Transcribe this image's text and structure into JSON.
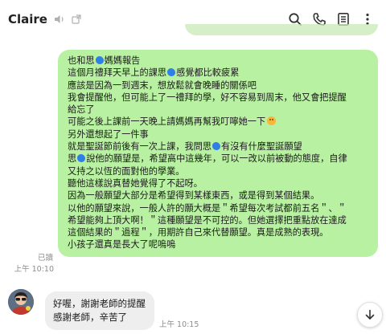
{
  "header": {
    "chat_name": "Claire",
    "icons": [
      "mute-icon",
      "external-window-icon",
      "search-icon",
      "call-icon",
      "notes-icon",
      "menu-icon"
    ]
  },
  "outgoing": {
    "lines": [
      {
        "before": "也和思",
        "blob": true,
        "after": "媽媽報告"
      },
      {
        "before": "這個月禮拜天早上的課思",
        "blob": true,
        "after": "感覺都比較疲累"
      },
      {
        "before": "應該是因為一到週末，想放鬆就會晚睡的關係吧",
        "blob": false,
        "after": ""
      },
      {
        "before": "我會提醒他，但可能上了一禮拜的學，好不容易到周末，他又會把提醒",
        "blob": false,
        "after": ""
      },
      {
        "before": "給忘了",
        "blob": false,
        "after": ""
      },
      {
        "before": "可能之後上課前一天晚上請媽媽再幫我叮嚀她一下",
        "blob": false,
        "after": "",
        "smile": true
      },
      {
        "before": "另外還想起了一件事",
        "blob": false,
        "after": ""
      },
      {
        "before": "就是聖誕節前後有一次上課，我問思",
        "blob": true,
        "after": "有沒有什麼聖誕願望"
      },
      {
        "before": "思",
        "blob": true,
        "after": "說他的願望是，希望高中這幾年，可以一改以前被動的態度，自律"
      },
      {
        "before": "又持之以恆的面對他的學業。",
        "blob": false,
        "after": ""
      },
      {
        "before": "聽他這樣說真替她覺得了不起呀。",
        "blob": false,
        "after": ""
      },
      {
        "before": "因為一般願望大部分是希望得到某樣東西，或是得到某個結果。",
        "blob": false,
        "after": ""
      },
      {
        "before": "以他的願望來說，一般人許的願大概是＂希望每次考試都前五名＂、＂",
        "blob": false,
        "after": ""
      },
      {
        "before": "希望能夠上頂大啊！＂這種願望是不可控的。但她選擇把重點放在達成",
        "blob": false,
        "after": ""
      },
      {
        "before": "這個結果的＂過程＂，用期許自己來代替願望。真是成熟的表現。",
        "blob": false,
        "after": ""
      },
      {
        "before": "小孩子還真是長大了呢嗚嗚",
        "blob": false,
        "after": ""
      }
    ],
    "read_label": "已讀",
    "time": "上午 10:10"
  },
  "incoming": {
    "lines": [
      "好喔，謝謝老師的提醒",
      "感謝老師，辛苦了"
    ],
    "time": "上午 10:15"
  },
  "colors": {
    "outgoing_bubble": "#b9f1a3",
    "incoming_bubble": "#eeeeee",
    "sticker_blob": "#2f7fe6"
  }
}
